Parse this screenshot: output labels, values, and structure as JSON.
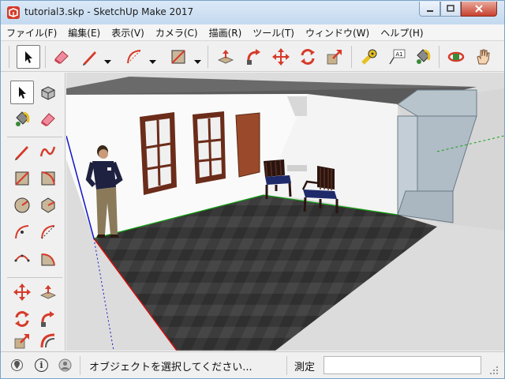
{
  "window": {
    "title": "tutorial3.skp - SketchUp Make 2017",
    "controls": {
      "minimize": "—",
      "maximize": "□",
      "close": "✕"
    }
  },
  "menubar": {
    "items": [
      {
        "label": "ファイル(F)"
      },
      {
        "label": "編集(E)"
      },
      {
        "label": "表示(V)"
      },
      {
        "label": "カメラ(C)"
      },
      {
        "label": "描画(R)"
      },
      {
        "label": "ツール(T)"
      },
      {
        "label": "ウィンドウ(W)"
      },
      {
        "label": "ヘルプ(H)"
      }
    ]
  },
  "toolbar": {
    "tools": [
      "select-arrow",
      "eraser",
      "pencil-line",
      "arc",
      "rectangle",
      "push-pull",
      "follow-me",
      "move",
      "rotate",
      "scale",
      "tape-measure",
      "text",
      "paint-bucket",
      "orbit",
      "pan-hand"
    ],
    "text_tool_label": "A1"
  },
  "left_toolbar": {
    "tools": [
      "select-arrow",
      "make-component",
      "paint-bucket",
      "eraser",
      "line",
      "freehand",
      "rectangle",
      "rotated-rectangle",
      "circle",
      "polygon",
      "arc",
      "arc-2pt",
      "arc-3pt",
      "pie",
      "move",
      "push-pull",
      "rotate",
      "follow-me",
      "scale",
      "offset"
    ]
  },
  "statusbar": {
    "info_icon": "i",
    "hint": "オブジェクトを選択してください...",
    "measure_label": "測定",
    "measure_value": ""
  },
  "colors": {
    "accent_red": "#d63b2a",
    "axis_red": "#d01010",
    "axis_green": "#10a010",
    "axis_blue": "#1414c8",
    "floor": "#3a3a3a",
    "ceiling": "#5a5a5a",
    "wall": "#fafafa",
    "window_frame": "#6b2c1a",
    "door": "#9a4a2a"
  }
}
